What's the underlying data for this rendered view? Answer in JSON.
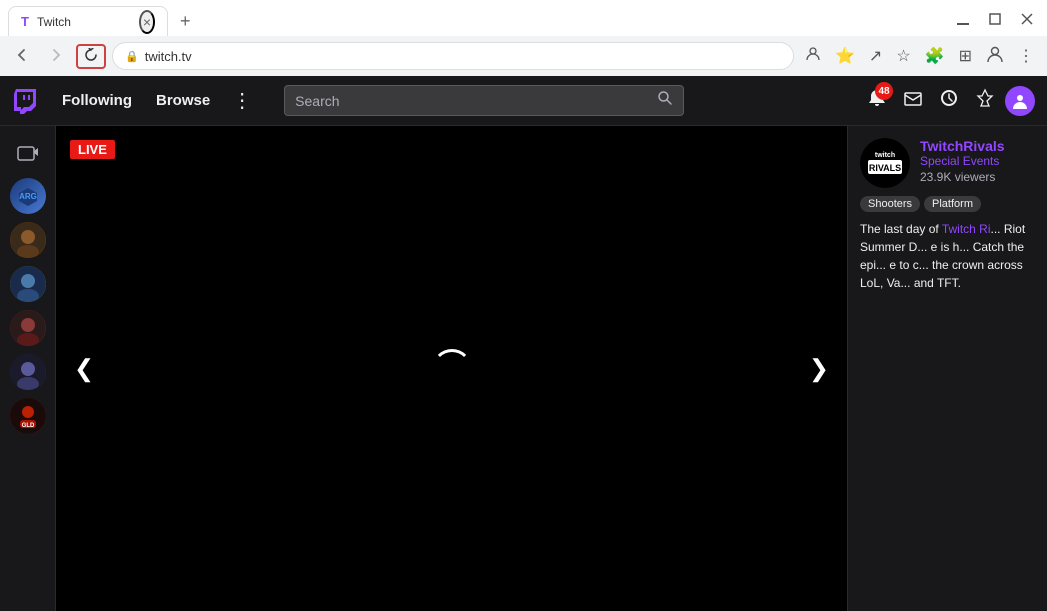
{
  "browser": {
    "tab": {
      "favicon": "T",
      "title": "Twitch",
      "close_label": "×"
    },
    "new_tab_label": "+",
    "window_controls": {
      "minimize": "–",
      "maximize": "❐",
      "close": "✕"
    },
    "nav": {
      "back_label": "←",
      "forward_label": "→",
      "refresh_label": "↻"
    },
    "url": "twitch.tv",
    "action_icons": [
      "⭐",
      "↗",
      "★",
      "🧩",
      "⊞",
      "👤",
      "⋮"
    ]
  },
  "twitch": {
    "header": {
      "following_label": "Following",
      "browse_label": "Browse",
      "more_label": "⋮",
      "search_placeholder": "Search",
      "search_icon": "🔍",
      "icons": {
        "notifications_label": "48",
        "inbox_label": "✉",
        "watchlist_label": "🔔",
        "crown_label": "◇"
      }
    },
    "sidebar": {
      "camera_icon": "📷",
      "channels": [
        {
          "id": "av1",
          "label": "Channel 1"
        },
        {
          "id": "av2",
          "label": "Channel 2"
        },
        {
          "id": "av3",
          "label": "Channel 3"
        },
        {
          "id": "av4",
          "label": "Channel 4"
        },
        {
          "id": "av5",
          "label": "Channel 5"
        },
        {
          "id": "av6",
          "label": "Channel 6"
        }
      ]
    },
    "video": {
      "live_label": "LIVE",
      "prev_arrow": "❮",
      "next_arrow": "❯"
    },
    "streamer": {
      "name": "TwitchRivals",
      "category": "Special Events",
      "viewers": "23.9K viewers",
      "logo_text": "twitch\nRIVALS",
      "tags": [
        "Shooters",
        "Platform"
      ],
      "description": "The last day of Twitch Ri... Riot Summer D... e is h... Catch the epi... e to c... the crown across LoL, Va... and TFT."
    }
  }
}
